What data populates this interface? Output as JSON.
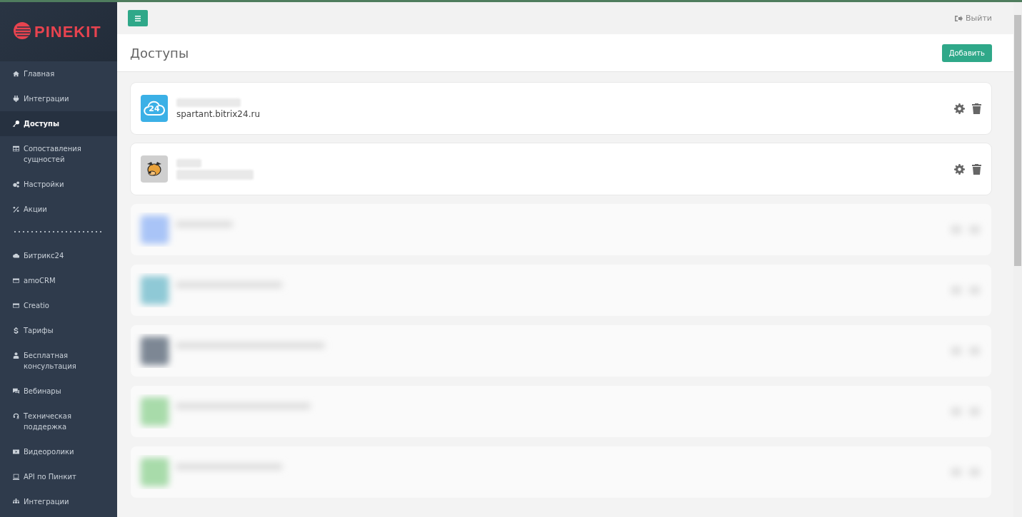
{
  "logo": {
    "text": "PINEKIT"
  },
  "sidebar": {
    "sections": [
      {
        "items": [
          {
            "label": "Главная",
            "selected": false
          },
          {
            "label": "Интеграции",
            "selected": false
          },
          {
            "label": "Доступы",
            "selected": true
          },
          {
            "label": "Сопоставления сущностей",
            "selected": false
          },
          {
            "label": "Настройки",
            "selected": false
          },
          {
            "label": "Акции",
            "selected": false
          }
        ]
      },
      {
        "items": [
          {
            "label": "Битрикс24",
            "selected": false
          },
          {
            "label": "amoCRM",
            "selected": false
          },
          {
            "label": "Creatio",
            "selected": false
          },
          {
            "label": "Тарифы",
            "selected": false
          },
          {
            "label": "Бесплатная консультация",
            "selected": false
          },
          {
            "label": "Вебинары",
            "selected": false
          },
          {
            "label": "Техническая поддержка",
            "selected": false
          },
          {
            "label": "Видеоролики",
            "selected": false
          },
          {
            "label": "API по Пинкит",
            "selected": false
          },
          {
            "label": "Интеграции",
            "selected": false
          }
        ]
      }
    ]
  },
  "topbar": {
    "logout": "Выйти"
  },
  "page": {
    "title": "Доступы",
    "add_button": "Добавить"
  },
  "cards": [
    {
      "kind": "bitrix",
      "logo_text": "24",
      "subtitle": "spartant.bitrix24.ru"
    },
    {
      "kind": "dog"
    }
  ],
  "blurred_cards": [
    {
      "color": "#a9c4f7"
    },
    {
      "color": "#8fc9d6"
    },
    {
      "color": "#7d8794"
    },
    {
      "color": "#a8dbaa"
    },
    {
      "color": "#a8dbaa"
    }
  ]
}
